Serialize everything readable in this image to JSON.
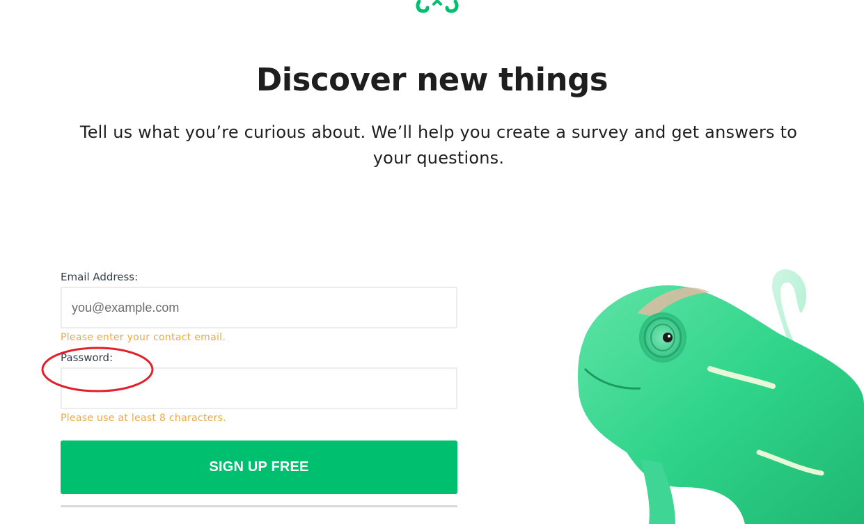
{
  "logo": {
    "icon": "brand-logo-icon",
    "color": "#00bf6f"
  },
  "hero": {
    "title": "Discover new things",
    "subtitle": "Tell us what you’re curious about. We’ll help you create a survey and get answers to your questions."
  },
  "form": {
    "email": {
      "label": "Email Address:",
      "placeholder": "you@example.com",
      "value": "",
      "error": "Please enter your contact email."
    },
    "password": {
      "label": "Password:",
      "value": "",
      "error": "Please use at least 8 characters."
    },
    "submit_label": "SIGN UP FREE"
  },
  "illustration": {
    "icon": "chameleon-image"
  },
  "colors": {
    "accent": "#00bf6f",
    "error": "#f0a73f",
    "annotation": "#e0202a"
  }
}
